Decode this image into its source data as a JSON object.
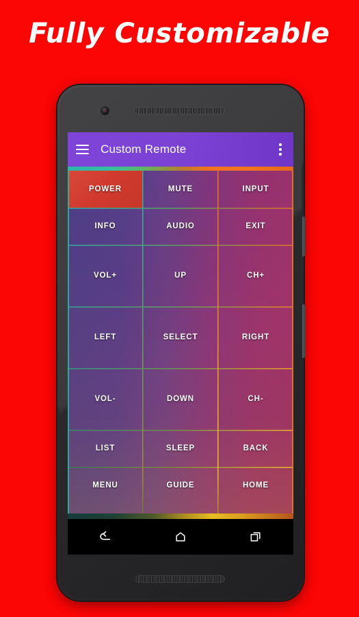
{
  "promo": {
    "headline": "Fully Customizable",
    "background_color": "#fb0505"
  },
  "app": {
    "title": "Custom Remote",
    "accent_color": "#7b41d4",
    "menu_icon": "hamburger-menu-icon",
    "overflow_icon": "overflow-menu-icon"
  },
  "remote": {
    "columns": 3,
    "rows": 7,
    "highlight_color": "#d03a2d",
    "buttons": [
      {
        "label": "POWER",
        "highlight": true
      },
      {
        "label": "MUTE",
        "highlight": false
      },
      {
        "label": "INPUT",
        "highlight": false
      },
      {
        "label": "INFO",
        "highlight": false
      },
      {
        "label": "AUDIO",
        "highlight": false
      },
      {
        "label": "EXIT",
        "highlight": false
      },
      {
        "label": "VOL+",
        "highlight": false
      },
      {
        "label": "UP",
        "highlight": false
      },
      {
        "label": "CH+",
        "highlight": false
      },
      {
        "label": "LEFT",
        "highlight": false
      },
      {
        "label": "SELECT",
        "highlight": false
      },
      {
        "label": "RIGHT",
        "highlight": false
      },
      {
        "label": "VOL-",
        "highlight": false
      },
      {
        "label": "DOWN",
        "highlight": false
      },
      {
        "label": "CH-",
        "highlight": false
      },
      {
        "label": "LIST",
        "highlight": false
      },
      {
        "label": "SLEEP",
        "highlight": false
      },
      {
        "label": "BACK",
        "highlight": false
      },
      {
        "label": "MENU",
        "highlight": false
      },
      {
        "label": "GUIDE",
        "highlight": false
      },
      {
        "label": "HOME",
        "highlight": false
      }
    ]
  },
  "navbar": {
    "back_icon": "back-arrow-icon",
    "home_icon": "home-icon",
    "recents_icon": "recent-apps-icon"
  },
  "device": {
    "camera_icon": "front-camera-icon",
    "top_speaker_icon": "earpiece-speaker-icon",
    "bottom_speaker_icon": "bottom-speaker-icon",
    "power_button": "power-side-button",
    "volume_button": "volume-rocker-button"
  }
}
